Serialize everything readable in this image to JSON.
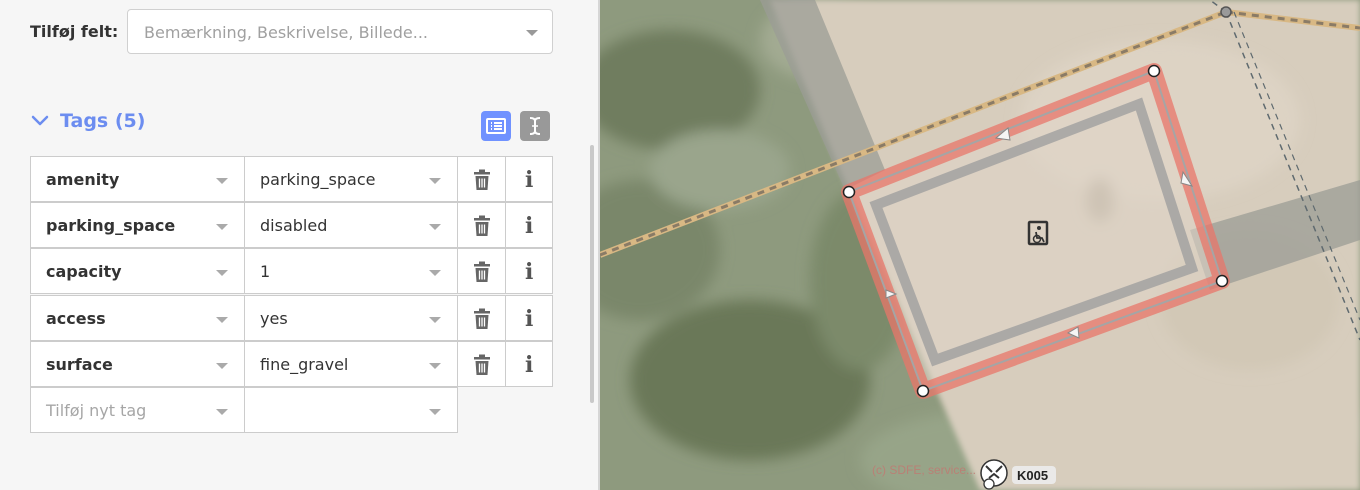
{
  "add_field": {
    "label": "Tilføj felt:",
    "placeholder": "Bemærkning, Beskrivelse, Billede..."
  },
  "tags_section": {
    "title": "Tags (5)"
  },
  "tags": [
    {
      "key": "amenity",
      "value": "parking_space"
    },
    {
      "key": "parking_space",
      "value": "disabled"
    },
    {
      "key": "capacity",
      "value": "1"
    },
    {
      "key": "access",
      "value": "yes"
    },
    {
      "key": "surface",
      "value": "fine_gravel"
    }
  ],
  "new_tag": {
    "key_placeholder": "Tilføj nyt tag",
    "value": ""
  },
  "map": {
    "attribution": "(c) SDFE, service...",
    "marker_label": "K005",
    "area_icon": "wheelchair-parking-icon"
  },
  "colors": {
    "accent": "#7092ff",
    "selection_outline": "#e8766a",
    "path_tan": "#d8b884"
  }
}
